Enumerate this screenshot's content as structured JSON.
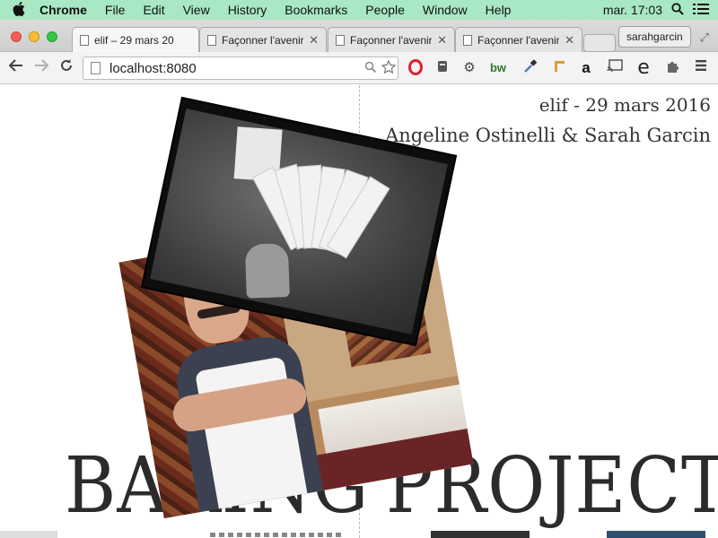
{
  "menubar": {
    "app_name": "Chrome",
    "items": [
      "File",
      "Edit",
      "View",
      "History",
      "Bookmarks",
      "People",
      "Window",
      "Help"
    ],
    "clock": "mar. 17:03"
  },
  "tabs": [
    {
      "label": "elif – 29 mars 20",
      "active": true
    },
    {
      "label": "Façonner l'avenir",
      "active": false
    },
    {
      "label": "Façonner l'avenir",
      "active": false
    },
    {
      "label": "Façonner l'avenir",
      "active": false
    }
  ],
  "profile_name": "sarahgarcin",
  "toolbar": {
    "url": "localhost:8080",
    "extensions": [
      "opera-icon",
      "evernote-icon",
      "gear-icon",
      "bw-icon",
      "eyedropper-icon",
      "ruler-icon",
      "amazon-icon",
      "cast-icon",
      "e-icon",
      "puzzle-icon",
      "menu-icon"
    ],
    "bw_label": "bw",
    "amazon_label": "a",
    "e_label": "e"
  },
  "page": {
    "date": "elif - 29 mars 2016",
    "authors": "Angeline Ostinelli & Sarah Garcin",
    "left_word": "BAKING",
    "right_word": "PROJECTS"
  },
  "colors": {
    "menubar": "#a8e8c4",
    "traffic_close": "#fc5c56",
    "traffic_min": "#fdbc2e",
    "traffic_max": "#33c748"
  }
}
